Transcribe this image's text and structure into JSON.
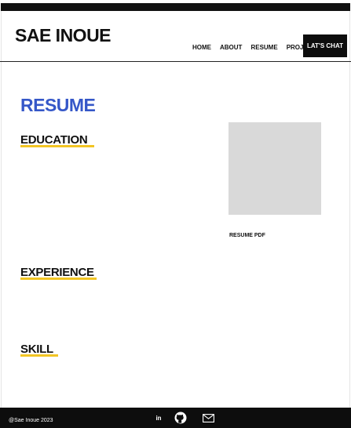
{
  "header": {
    "brand": "SAE INOUE",
    "nav": [
      "HOME",
      "ABOUT",
      "RESUME",
      "PROJECT"
    ],
    "cta": "LAT'S CHAT"
  },
  "main": {
    "title": "RESUME",
    "sections": {
      "education": "EDUCATION",
      "experience": "EXPERIENCE",
      "skill": "SKILL"
    },
    "resume_pdf_label": "RESUME PDF"
  },
  "footer": {
    "copyright": "@Sae Inoue 2023",
    "linkedin_text": "in",
    "icons": [
      "linkedin-icon",
      "github-icon",
      "mail-icon"
    ]
  },
  "colors": {
    "accent": "#3557c8",
    "underline": "#f2c523",
    "dark": "#0d0d0d",
    "placeholder": "#d9d9d9"
  }
}
